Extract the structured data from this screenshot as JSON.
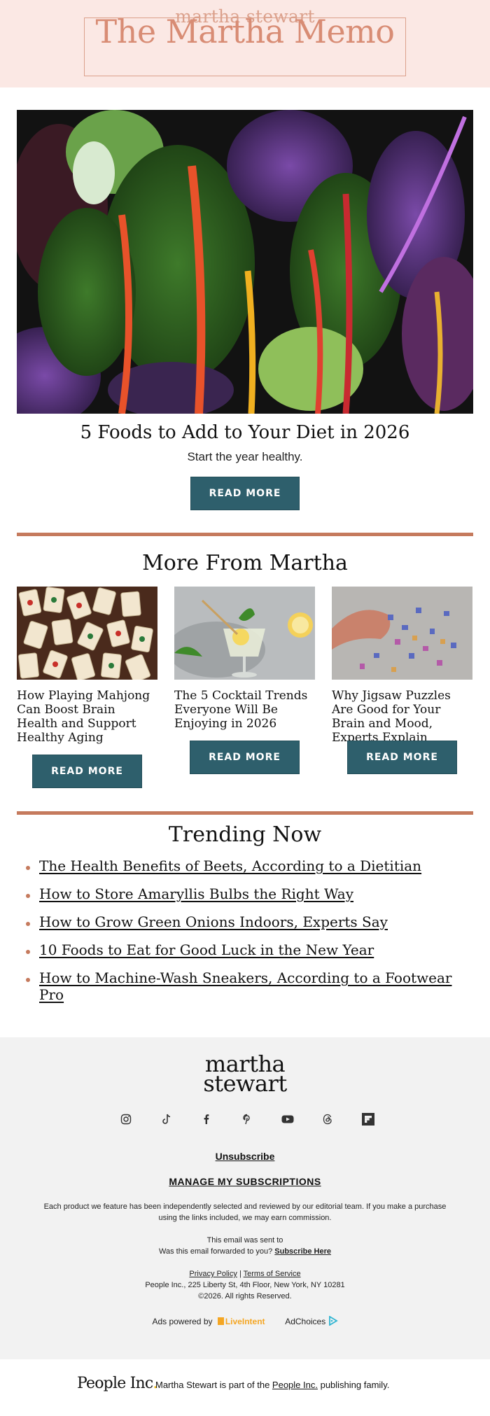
{
  "header": {
    "brand": "martha stewart",
    "newsletter_title": "The Martha Memo"
  },
  "hero": {
    "title": "5 Foods to Add to Your Diet in 2026",
    "subtitle": "Start the year healthy.",
    "button_label": "READ MORE"
  },
  "more": {
    "heading": "More From Martha",
    "cards": [
      {
        "title": "How Playing Mahjong Can Boost Brain Health and Support Healthy Aging",
        "button_label": "READ MORE"
      },
      {
        "title": "The 5 Cocktail Trends Everyone Will Be Enjoying in 2026",
        "button_label": "READ MORE"
      },
      {
        "title": "Why Jigsaw Puzzles Are Good for Your Brain and Mood, Experts Explain",
        "button_label": "READ MORE"
      }
    ]
  },
  "trending": {
    "heading": "Trending Now",
    "items": [
      "The Health Benefits of Beets, According to a Dietitian",
      "How to Store Amaryllis Bulbs the Right Way",
      "How to Grow Green Onions Indoors, Experts Say",
      "10 Foods to Eat for Good Luck in the New Year",
      "How to Machine-Wash Sneakers, According to a Footwear Pro"
    ]
  },
  "footer": {
    "logo_line1": "martha",
    "logo_line2": "stewart",
    "social_icons": [
      "instagram-icon",
      "tiktok-icon",
      "facebook-icon",
      "pinterest-icon",
      "youtube-icon",
      "threads-icon",
      "flipboard-icon"
    ],
    "unsubscribe": "Unsubscribe",
    "manage": "MANAGE MY SUBSCRIPTIONS",
    "disclosure": "Each product we feature has been independently selected and reviewed by our editorial team. If you make a purchase using the links included, we may earn commission.",
    "sent_to": "This email was sent to",
    "forwarded": "Was this email forwarded to you?",
    "subscribe_here": "Subscribe Here",
    "privacy": "Privacy Policy",
    "separator": "|",
    "terms": "Terms of Service",
    "address": "People Inc., 225 Liberty St, 4th Floor, New York, NY 10281",
    "copyright": "©2026. All rights Reserved.",
    "ads_powered": "Ads powered by",
    "liveintent": "LiveIntent",
    "adchoices": "AdChoices"
  },
  "bottom": {
    "people_logo": "People Inc",
    "people_logo_dot": ".",
    "family_text_pre": "Martha Stewart is part of the",
    "family_link": "People Inc.",
    "family_text_post": "publishing family."
  },
  "colors": {
    "header_bg": "#fbe8e4",
    "brand_accent": "#d88c74",
    "button": "#2e5f6c",
    "divider": "#c57a5d",
    "footer_bg": "#f2f2f2"
  }
}
